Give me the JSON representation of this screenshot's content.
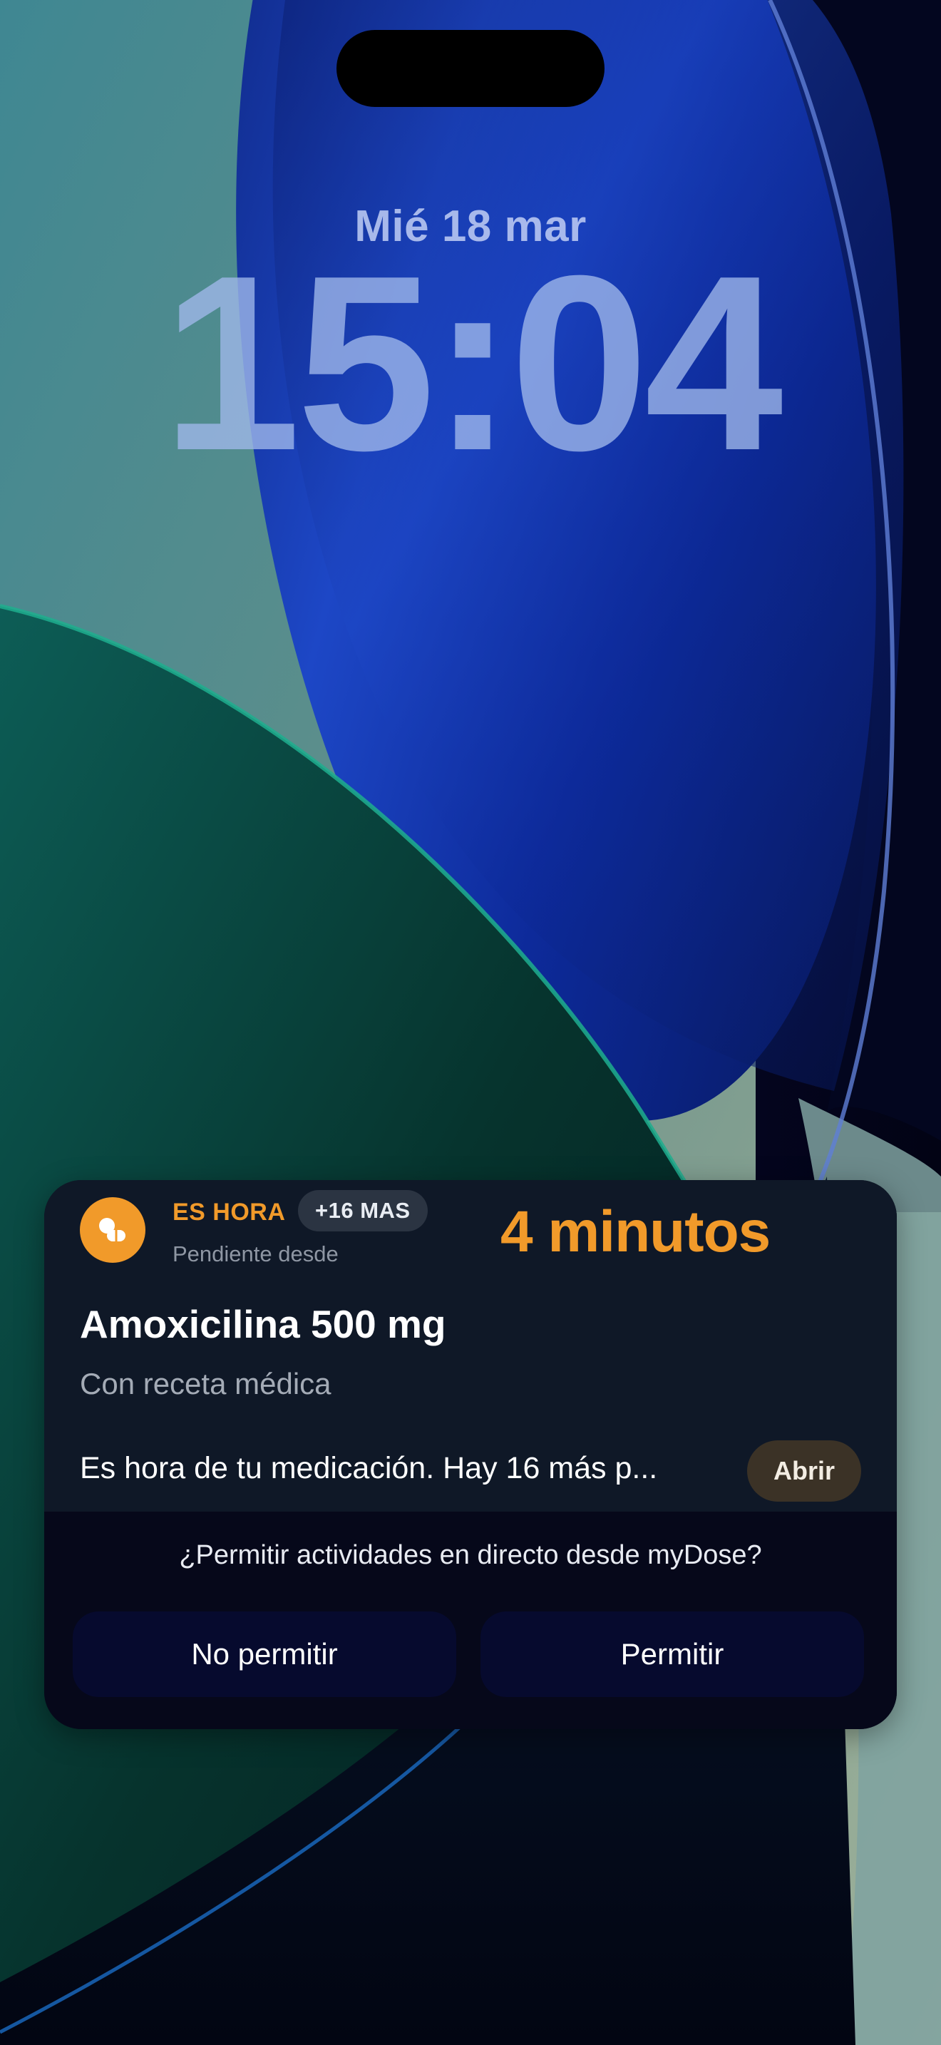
{
  "lock_screen": {
    "date": "Mié 18 mar",
    "time": "15:04"
  },
  "live_activity": {
    "app_icon": "pill-icon",
    "status_label": "ES HORA",
    "badge": "+16 MAS",
    "pending_label": "Pendiente desde",
    "elapsed": "4 minutos",
    "medication_name": "Amoxicilina 500 mg",
    "medication_subtitle": "Con receta médica",
    "message": "Es hora de tu medicación. Hay 16 más p...",
    "open_button": "Abrir"
  },
  "permission": {
    "question": "¿Permitir actividades en directo desde myDose?",
    "deny_button": "No permitir",
    "allow_button": "Permitir"
  },
  "colors": {
    "accent": "#f19a2a",
    "card_background": "#0f1827",
    "permission_background": "#06081a"
  }
}
